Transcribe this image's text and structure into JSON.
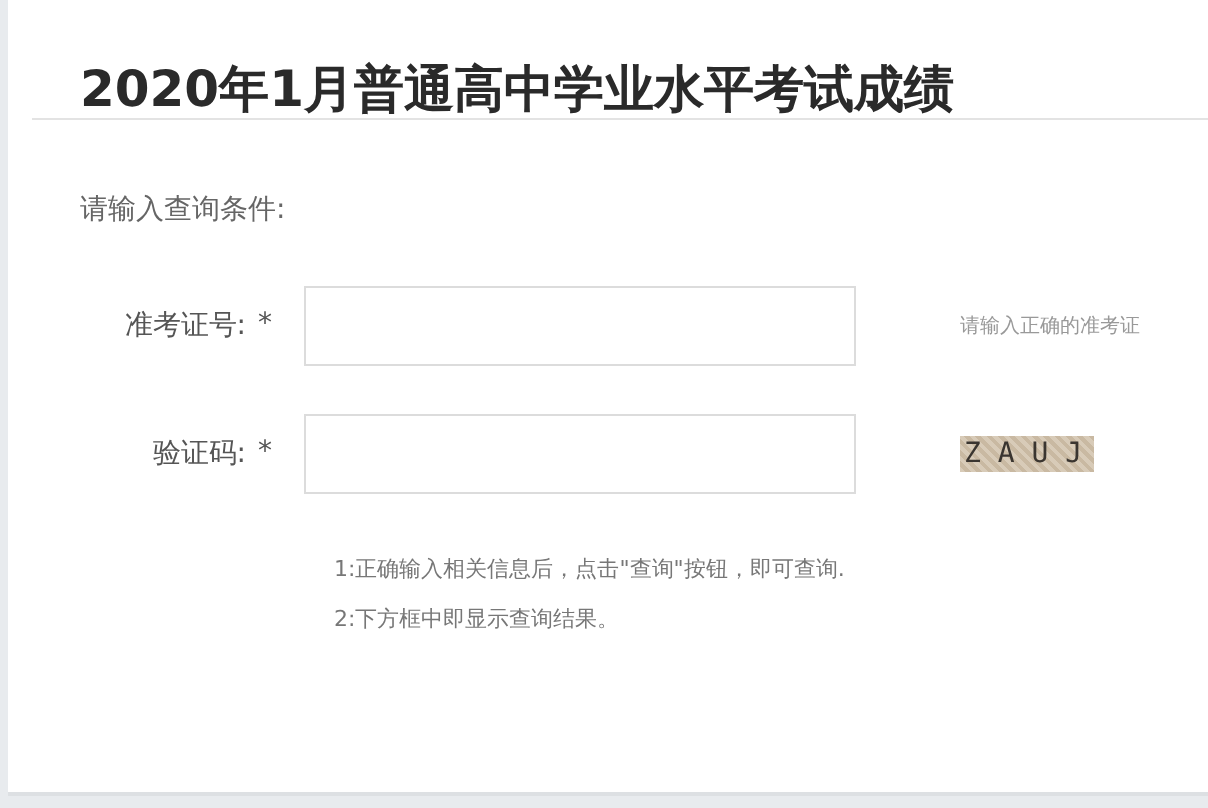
{
  "title": "2020年1月普通高中学业水平考试成绩",
  "prompt": "请输入查询条件:",
  "fields": [
    {
      "label": "准考证号:",
      "required_mark": "*",
      "kind": "hint",
      "side": "请输入正确的准考证"
    },
    {
      "label": "验证码:",
      "required_mark": "*",
      "kind": "captcha",
      "side": "Z A U J"
    }
  ],
  "notes": [
    "1:正确输入相关信息后，点击\"查询\"按钮，即可查询.",
    "2:下方框中即显示查询结果。"
  ]
}
